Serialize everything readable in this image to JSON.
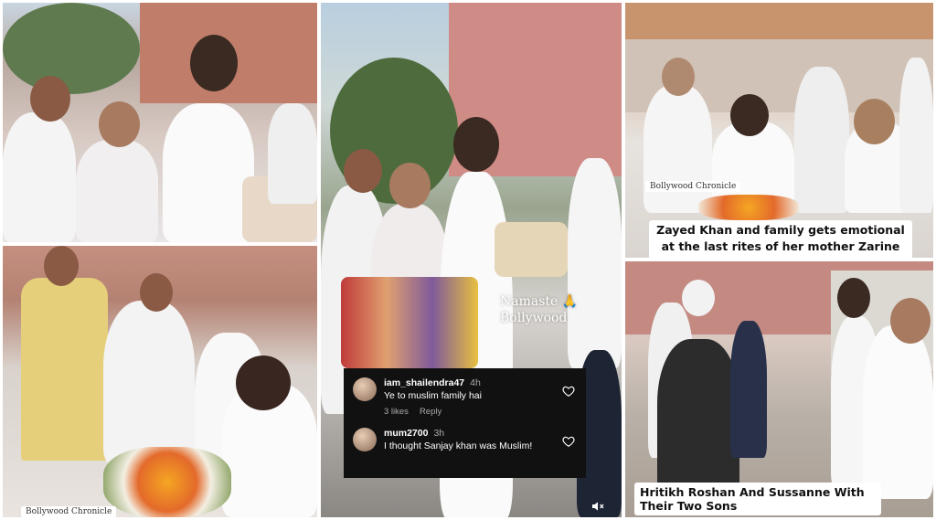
{
  "panels": {
    "top_left": {
      "watermark": ""
    },
    "bottom_left": {
      "watermark": "Bollywood Chronicle"
    },
    "center": {
      "overlay_text_line1": "Namaste 🙏",
      "overlay_text_line2": "Bollywood",
      "comments": [
        {
          "username": "iam_shailendra47",
          "time": "4h",
          "text": "Ye to muslim family hai",
          "likes": "3 likes",
          "reply": "Reply"
        },
        {
          "username": "mum2700",
          "time": "3h",
          "text": "I thought Sanjay khan was Muslim!",
          "likes": "",
          "reply": ""
        }
      ]
    },
    "top_right": {
      "watermark": "Bollywood Chronicle",
      "caption": "Zayed Khan and family gets emotional at the last rites of her mother Zarine Khan"
    },
    "bottom_right": {
      "caption": "Hritikh Roshan And Sussanne With Their Two Sons"
    }
  },
  "colors": {
    "comment_bg": "#111111",
    "caption_bg": "#ffffff"
  },
  "icons": [
    "heart-icon",
    "mute-icon",
    "pray-hands-icon"
  ]
}
